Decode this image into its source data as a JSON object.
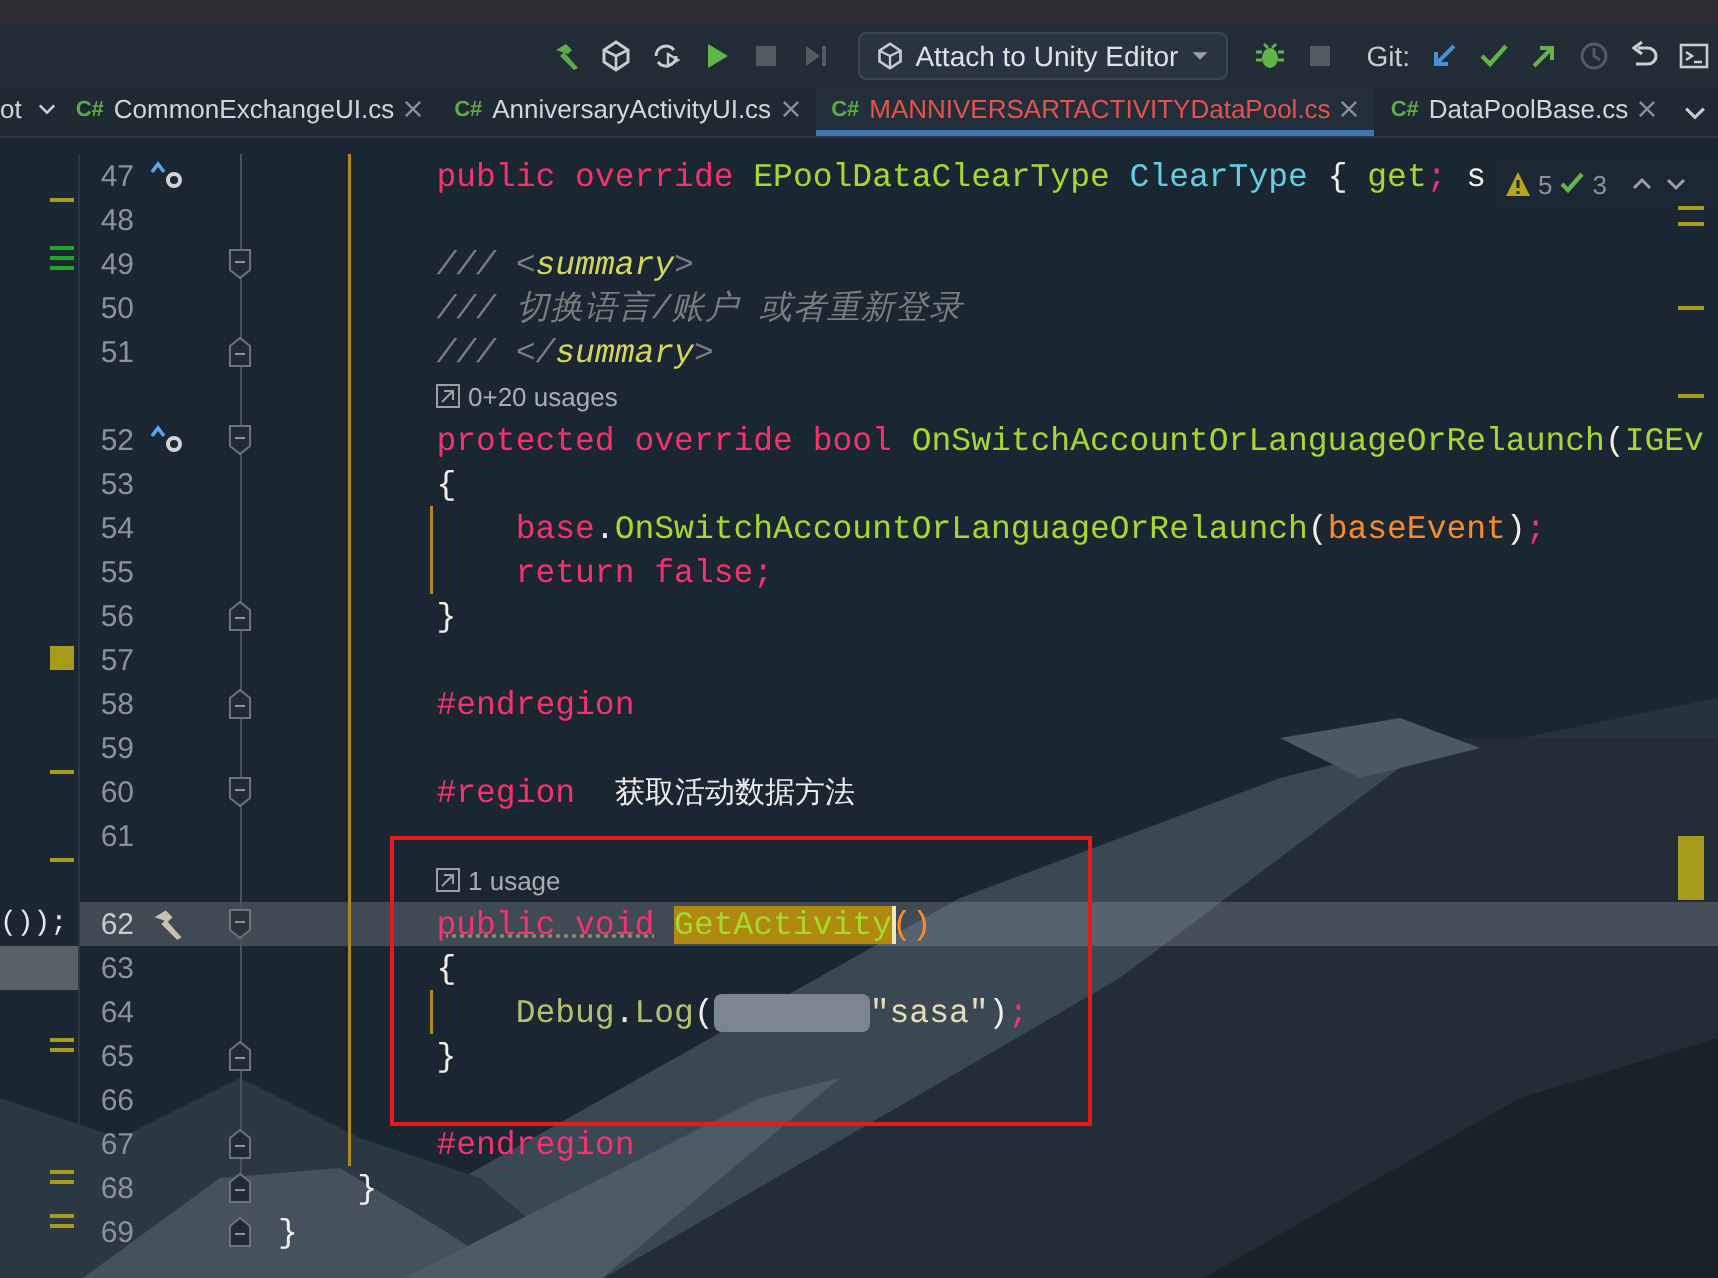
{
  "toolbar": {
    "items": [
      {
        "kind": "build",
        "disabled": false
      },
      {
        "kind": "unity",
        "disabled": false
      },
      {
        "kind": "unity-refresh",
        "disabled": false
      },
      {
        "kind": "run",
        "disabled": false
      },
      {
        "kind": "stop",
        "disabled": true
      },
      {
        "kind": "step",
        "disabled": true
      },
      {
        "kind": "run_config",
        "label": "Attach to Unity Editor"
      },
      {
        "kind": "debug",
        "disabled": false
      },
      {
        "kind": "stop",
        "disabled": true
      },
      {
        "kind": "label",
        "text": "Git:"
      },
      {
        "kind": "git-update",
        "disabled": false
      },
      {
        "kind": "git-commit",
        "disabled": false
      },
      {
        "kind": "git-push",
        "disabled": false
      },
      {
        "kind": "history",
        "disabled": true
      },
      {
        "kind": "rollback",
        "disabled": false
      },
      {
        "kind": "terminal",
        "disabled": false
      }
    ]
  },
  "tabs": [
    {
      "label": "ot",
      "selected": false
    },
    {
      "badge": "C#",
      "label": "CommonExchangeUI.cs",
      "selected": false
    },
    {
      "badge": "C#",
      "label": "AnniversaryActivityUI.cs",
      "selected": false
    },
    {
      "badge": "C#",
      "label": "MANNIVERSARTACTIVITYDataPool.cs",
      "selected": true
    },
    {
      "badge": "C#",
      "label": "DataPoolBase.cs",
      "selected": false
    }
  ],
  "editor": {
    "inspections": {
      "warnings": "5",
      "checks": "3"
    },
    "rows": [
      {
        "kind": "code",
        "number": "47",
        "gutter": {
          "kind": "override"
        },
        "tokens": [
          {
            "kind": "kw",
            "text": "        public override "
          },
          {
            "kind": "type",
            "text": "EPoolDataClearType "
          },
          {
            "kind": "prop",
            "text": "ClearType "
          },
          {
            "kind": "punct",
            "text": "{ "
          },
          {
            "kind": "type",
            "text": "get"
          },
          {
            "kind": "kw",
            "text": ";"
          },
          {
            "kind": "punct",
            "text": " s"
          }
        ]
      },
      {
        "kind": "code",
        "number": "48",
        "left_marker": {
          "kind": "dash"
        },
        "right_marker": {
          "kind": "double"
        },
        "tokens": []
      },
      {
        "kind": "code",
        "number": "49",
        "fold": {
          "kind": "start"
        },
        "left_marker": {
          "kind": "added"
        },
        "tokens": [
          {
            "kind": "comment",
            "text": "        /// <"
          },
          {
            "kind": "doc",
            "text": "summary"
          },
          {
            "kind": "comment",
            "text": ">"
          }
        ]
      },
      {
        "kind": "code",
        "number": "50",
        "right_marker": {
          "kind": "dash"
        },
        "tokens": [
          {
            "kind": "comment",
            "text": "        /// 切换语言/账户 或者重新登录"
          }
        ]
      },
      {
        "kind": "code",
        "number": "51",
        "fold": {
          "kind": "end"
        },
        "tokens": [
          {
            "kind": "comment",
            "text": "        /// </"
          },
          {
            "kind": "doc",
            "text": "summary"
          },
          {
            "kind": "comment",
            "text": ">"
          }
        ]
      },
      {
        "kind": "usages",
        "text": "0+20 usages",
        "right_marker": {
          "kind": "dash"
        }
      },
      {
        "kind": "code",
        "number": "52",
        "gutter": {
          "kind": "override"
        },
        "fold": {
          "kind": "start"
        },
        "tokens": [
          {
            "kind": "kw",
            "text": "        protected override bool "
          },
          {
            "kind": "method",
            "text": "OnSwitchAccountOrLanguageOrRelaunch"
          },
          {
            "kind": "punct",
            "text": "("
          },
          {
            "kind": "type",
            "text": "IGEv"
          }
        ]
      },
      {
        "kind": "code",
        "number": "53",
        "tokens": [
          {
            "kind": "punct",
            "text": "        {"
          }
        ]
      },
      {
        "kind": "code",
        "number": "54",
        "tokens": [
          {
            "kind": "kw",
            "text": "            base"
          },
          {
            "kind": "punct",
            "text": "."
          },
          {
            "kind": "method",
            "text": "OnSwitchAccountOrLanguageOrRelaunch"
          },
          {
            "kind": "punct",
            "text": "("
          },
          {
            "kind": "param",
            "text": "baseEvent"
          },
          {
            "kind": "punct",
            "text": ")"
          },
          {
            "kind": "kw",
            "text": ";"
          }
        ]
      },
      {
        "kind": "code",
        "number": "55",
        "tokens": [
          {
            "kind": "kw",
            "text": "            return false;"
          }
        ]
      },
      {
        "kind": "code",
        "number": "56",
        "fold": {
          "kind": "end"
        },
        "tokens": [
          {
            "kind": "punct",
            "text": "        }"
          }
        ]
      },
      {
        "kind": "code",
        "number": "57",
        "left_marker": {
          "kind": "block"
        },
        "tokens": []
      },
      {
        "kind": "code",
        "number": "58",
        "fold": {
          "kind": "end"
        },
        "tokens": [
          {
            "kind": "kw",
            "text": "        #endregion"
          }
        ]
      },
      {
        "kind": "code",
        "number": "59",
        "tokens": []
      },
      {
        "kind": "code",
        "number": "60",
        "fold": {
          "kind": "start"
        },
        "left_marker": {
          "kind": "dash"
        },
        "tokens": [
          {
            "kind": "kw",
            "text": "        #region  "
          },
          {
            "kind": "region",
            "text": "获取活动数据方法"
          }
        ]
      },
      {
        "kind": "code",
        "number": "61",
        "right_marker": {
          "kind": "block"
        },
        "tokens": []
      },
      {
        "kind": "usages",
        "text": "1 usage",
        "left_marker": {
          "kind": "dash"
        }
      },
      {
        "kind": "code",
        "number": "62",
        "gutter": {
          "kind": "build"
        },
        "fold": {
          "kind": "start"
        },
        "current": true,
        "left_text": "());",
        "tokens": [
          {
            "kind": "kw-warn",
            "text": "        public void "
          },
          {
            "kind": "match",
            "text": "GetActivity"
          },
          {
            "kind": "paren",
            "text": "()"
          }
        ]
      },
      {
        "kind": "code",
        "number": "63",
        "left_current": true,
        "tokens": [
          {
            "kind": "punct",
            "text": "        {"
          }
        ]
      },
      {
        "kind": "code",
        "number": "64",
        "tokens": [
          {
            "kind": "dim-type",
            "text": "            Debug"
          },
          {
            "kind": "punct",
            "text": "."
          },
          {
            "kind": "dim-type",
            "text": "Log"
          },
          {
            "kind": "punct",
            "text": "("
          },
          {
            "kind": "hint"
          },
          {
            "kind": "string",
            "text": "\"sasa\""
          },
          {
            "kind": "punct",
            "text": ")"
          },
          {
            "kind": "kw",
            "text": ";"
          }
        ]
      },
      {
        "kind": "code",
        "number": "65",
        "fold": {
          "kind": "end"
        },
        "left_marker": {
          "kind": "double"
        },
        "tokens": [
          {
            "kind": "punct",
            "text": "        }"
          }
        ]
      },
      {
        "kind": "code",
        "number": "66",
        "tokens": []
      },
      {
        "kind": "code",
        "number": "67",
        "fold": {
          "kind": "end"
        },
        "tokens": [
          {
            "kind": "kw",
            "text": "        #endregion"
          }
        ]
      },
      {
        "kind": "code",
        "number": "68",
        "fold": {
          "kind": "end"
        },
        "left_marker": {
          "kind": "double"
        },
        "tokens": [
          {
            "kind": "punct",
            "text": "    }"
          }
        ]
      },
      {
        "kind": "code",
        "number": "69",
        "fold": {
          "kind": "end"
        },
        "left_marker": {
          "kind": "double"
        },
        "tokens": [
          {
            "kind": "punct",
            "text": "}"
          }
        ]
      }
    ]
  }
}
